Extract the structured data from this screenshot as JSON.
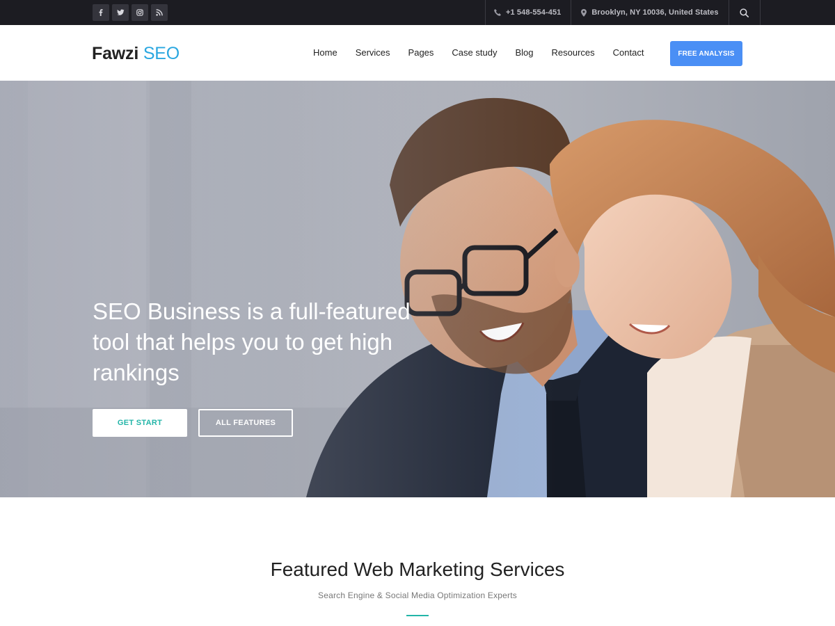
{
  "topbar": {
    "social": [
      "facebook-icon",
      "twitter-icon",
      "instagram-icon",
      "rss-icon"
    ],
    "phone": "+1 548-554-451",
    "address": "Brooklyn, NY 10036, United States"
  },
  "header": {
    "logo_part1": "Fawzi",
    "logo_part2": "SEO",
    "nav": [
      "Home",
      "Services",
      "Pages",
      "Case study",
      "Blog",
      "Resources",
      "Contact"
    ],
    "cta_label": "FREE ANALYSIS"
  },
  "hero": {
    "title": "SEO Business is a full-featured tool that helps you to get high rankings",
    "primary_button": "GET START",
    "secondary_button": "ALL FEATURES"
  },
  "featured": {
    "title": "Featured Web Marketing Services",
    "subtitle": "Search Engine & Social Media Optimization Experts"
  },
  "colors": {
    "topbar_bg": "#1c1c22",
    "accent_blue": "#4a8ff5",
    "logo_blue": "#2aa7e0",
    "accent_teal": "#23b5a8"
  }
}
